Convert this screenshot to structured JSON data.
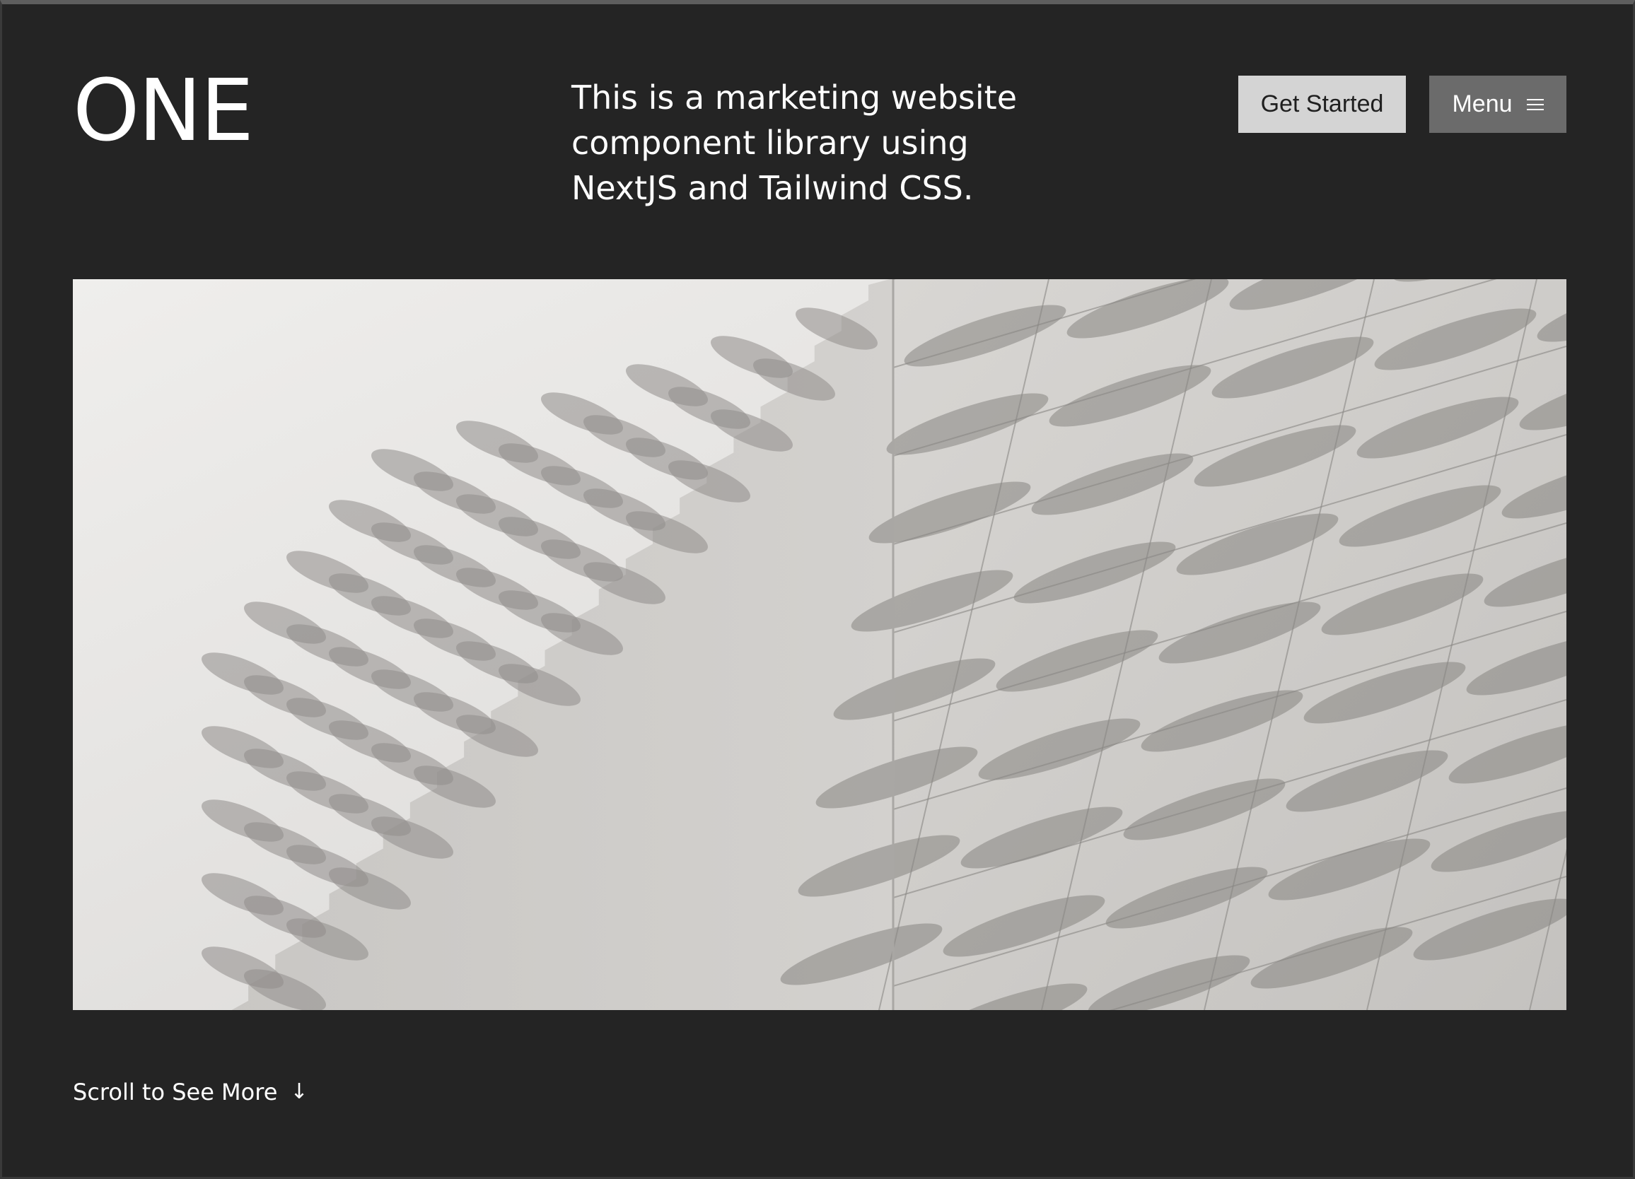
{
  "brand": {
    "logo": "ONE"
  },
  "hero": {
    "tagline": "This is a marketing website component library using NextJS and Tailwind CSS."
  },
  "nav": {
    "get_started_label": "Get Started",
    "menu_label": "Menu"
  },
  "image": {
    "subject": "building-facade-photo"
  },
  "footer": {
    "scroll_label": "Scroll to See More",
    "scroll_icon": "arrow-down-icon"
  },
  "colors": {
    "background": "#242424",
    "primary_button": "#d4d4d4",
    "secondary_button": "#6b6b6b",
    "text": "#ffffff"
  }
}
